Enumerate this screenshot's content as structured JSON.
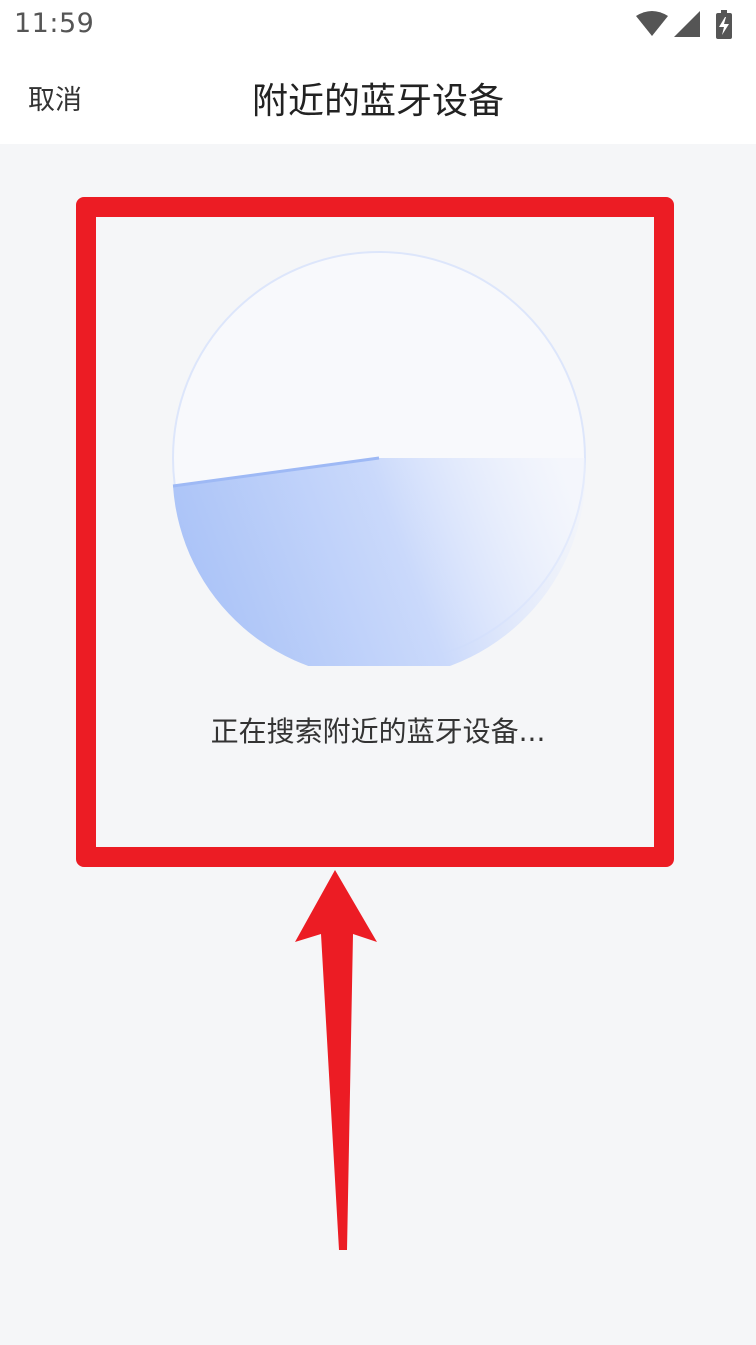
{
  "status_bar": {
    "time": "11:59",
    "icons": [
      "wifi-icon",
      "cellular-signal-icon",
      "battery-charging-icon"
    ]
  },
  "header": {
    "cancel_label": "取消",
    "title": "附近的蓝牙设备"
  },
  "main": {
    "search_status": "正在搜索附近的蓝牙设备..."
  },
  "colors": {
    "radar_accent": "#aac3f8",
    "annotation": "#ec1c24"
  }
}
